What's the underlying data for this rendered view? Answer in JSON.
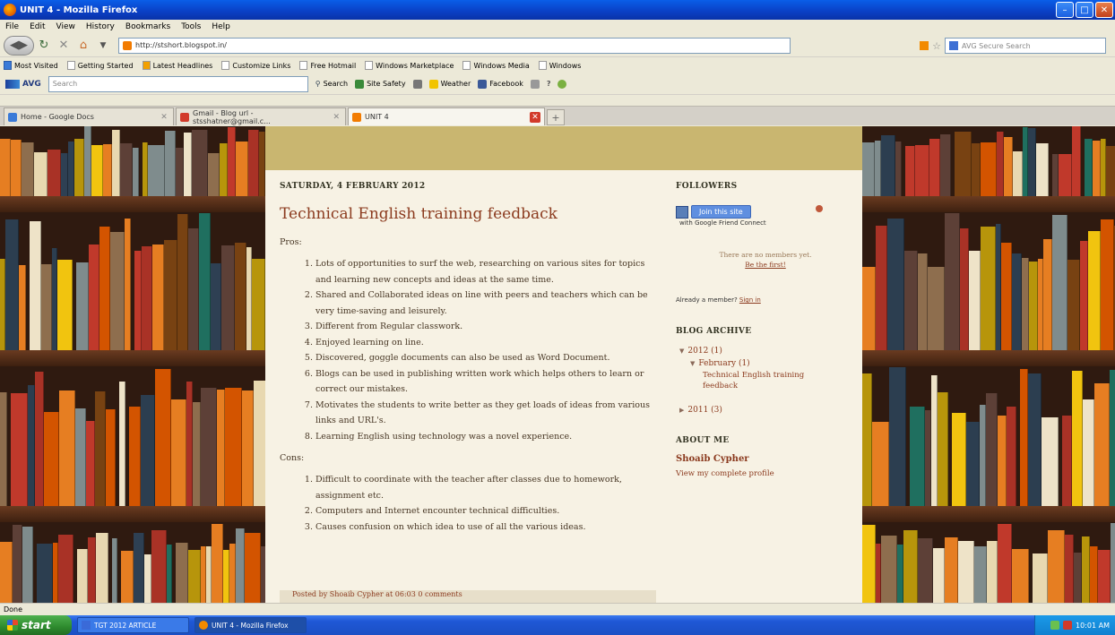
{
  "window": {
    "title": "UNIT 4 - Mozilla Firefox"
  },
  "menu": [
    "File",
    "Edit",
    "View",
    "History",
    "Bookmarks",
    "Tools",
    "Help"
  ],
  "nav": {
    "url": "http://stshort.blogspot.in/",
    "search_placeholder": "AVG Secure Search"
  },
  "bookmarks": [
    "Most Visited",
    "Getting Started",
    "Latest Headlines",
    "Customize Links",
    "Free Hotmail",
    "Windows Marketplace",
    "Windows Media",
    "Windows"
  ],
  "avg": {
    "label": "AVG",
    "search_placeholder": "Search",
    "search": "Search",
    "site_safety": "Site Safety",
    "weather": "Weather",
    "facebook": "Facebook"
  },
  "tabs": [
    {
      "label": "Home - Google Docs",
      "color": "#3a7ad8"
    },
    {
      "label": "Gmail - Blog url - stsshatner@gmail.c...",
      "color": "#d23a2a"
    },
    {
      "label": "UNIT 4",
      "color": "#f27b00"
    }
  ],
  "post": {
    "date": "SATURDAY, 4 FEBRUARY 2012",
    "title": "Technical English training feedback",
    "pros_label": "Pros:",
    "pros": [
      "Lots of opportunities to surf the web, researching on various sites for topics and learning new concepts and ideas at the same time.",
      "Shared and Collaborated ideas on line with peers and teachers which can be very time-saving and leisurely.",
      "Different from Regular classwork.",
      "Enjoyed learning on line.",
      "Discovered, goggle documents can also be used as Word Document.",
      "Blogs can be used in publishing written work which helps others to learn or correct our mistakes.",
      "Motivates the students to write better as they get loads of ideas from various links and URL's.",
      "Learning English using technology was a novel experience."
    ],
    "cons_label": "Cons:",
    "cons": [
      "Difficult to coordinate with the teacher after classes due to homework, assignment etc.",
      "Computers and Internet encounter technical difficulties.",
      "Causes confusion on which idea to use of all the various ideas."
    ],
    "footer": "Posted by Shoaib Cypher at 06:03    0 comments"
  },
  "sidebar": {
    "followers_title": "FOLLOWERS",
    "join_label": "Join this site",
    "gfc_label": "with Google Friend Connect",
    "no_members": "There are no members yet.",
    "be_first": "Be the first!",
    "already_member": "Already a member?",
    "sign_in": "Sign in",
    "archive_title": "BLOG ARCHIVE",
    "archive": [
      {
        "label": "2012 (1)"
      },
      {
        "label": "February (1)"
      },
      {
        "label": "Technical English training feedback"
      },
      {
        "label": "2011 (3)"
      }
    ],
    "about_title": "ABOUT ME",
    "author": "Shoaib Cypher",
    "profile_link": "View my complete profile"
  },
  "status": {
    "text": "Done"
  },
  "taskbar": {
    "start": "start",
    "items": [
      "TGT 2012 ARTICLE",
      "UNIT 4 - Mozilla Firefox"
    ],
    "clock": "10:01 AM"
  }
}
